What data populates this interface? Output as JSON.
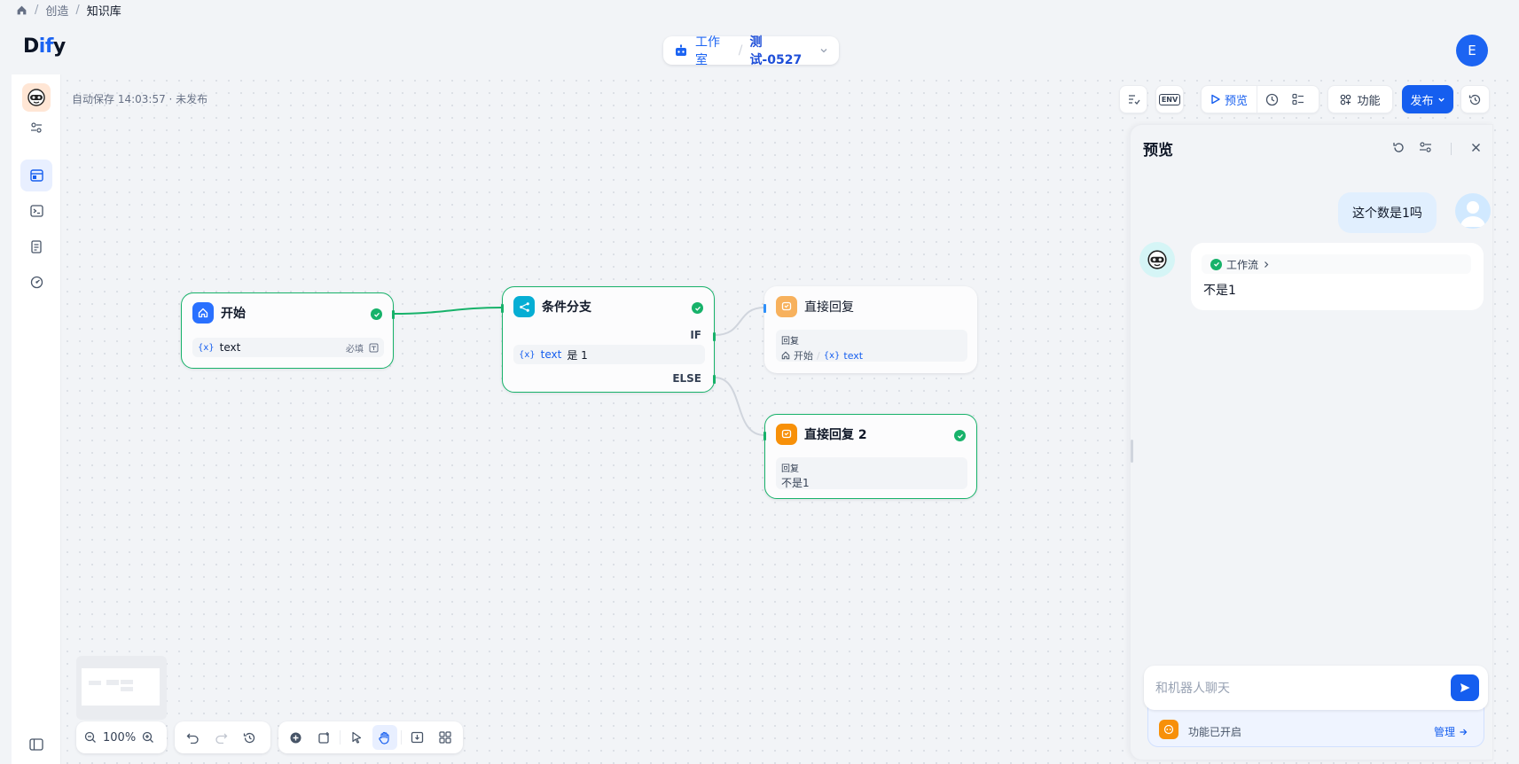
{
  "breadcrumb": {
    "create": "创造",
    "sep": "/",
    "current": "知识库"
  },
  "header": {
    "logo_d": "D",
    "logo_i": "i",
    "logo_f": "f",
    "logo_y": "y",
    "studio": "工作室",
    "slash": "/",
    "app_name": "测试-0527",
    "avatar_initial": "E"
  },
  "canvas": {
    "autosave": "自动保存 14:03:57 · 未发布"
  },
  "toolbar": {
    "env": "ENV",
    "preview": "预览",
    "features": "功能",
    "publish": "发布"
  },
  "nodes": {
    "start": {
      "title": "开始",
      "var_name": "text",
      "required": "必填"
    },
    "ifelse": {
      "title": "条件分支",
      "if_label": "IF",
      "else_label": "ELSE",
      "cond_var": "text",
      "cond_op": "是 1"
    },
    "answer1": {
      "title": "直接回复",
      "label": "回复",
      "ref_node": "开始",
      "ref_var": "text"
    },
    "answer2": {
      "title": "直接回复 2",
      "label": "回复",
      "text": "不是1"
    }
  },
  "zoom": {
    "level": "100%"
  },
  "preview": {
    "title": "预览",
    "user_message": "这个数是1吗",
    "workflow_chip": "工作流",
    "bot_reply": "不是1",
    "input_placeholder": "和机器人聊天",
    "features_enabled": "功能已开启",
    "manage": "管理"
  },
  "colors": {
    "accent": "#155eef",
    "success": "#17b26a",
    "answer_orange": "#f79009",
    "ifelse_cyan": "#06aed4"
  }
}
